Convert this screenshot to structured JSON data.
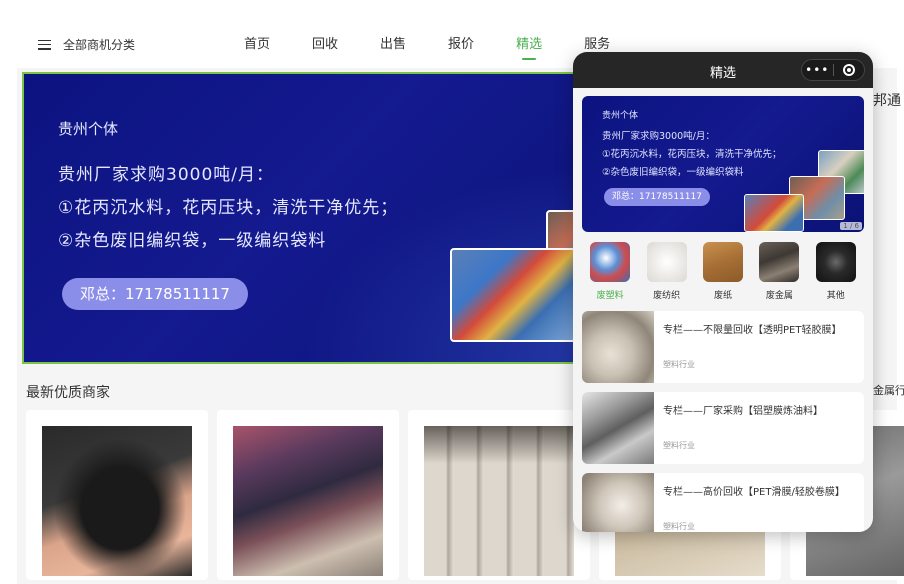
{
  "topnav": {
    "category_label": "全部商机分类",
    "items": [
      {
        "label": "首页",
        "active": false
      },
      {
        "label": "回收",
        "active": false
      },
      {
        "label": "出售",
        "active": false
      },
      {
        "label": "报价",
        "active": false
      },
      {
        "label": "精选",
        "active": true
      },
      {
        "label": "服务",
        "active": false
      }
    ],
    "accent_color": "#4caf50"
  },
  "hero": {
    "owner": "贵州个体",
    "line1": "贵州厂家求购3000吨/月：",
    "line2": "①花丙沉水料，花丙压块，清洗干净优先；",
    "line3": "②杂色废旧编织袋，一级编织袋料",
    "contact": "邓总：17178511117",
    "border_color": "#7cc544",
    "bg_color": "#0c1380"
  },
  "section": {
    "title": "最新优质商家"
  },
  "partial_right": {
    "text1": "邦通",
    "text2": "金属行"
  },
  "phone": {
    "title": "精选",
    "capsule_more": "•••",
    "banner": {
      "owner": "贵州个体",
      "line1": "贵州厂家求购3000吨/月：",
      "line2": "①花丙沉水料，花丙压块，清洗干净优先；",
      "line3": "②杂色废旧编织袋，一级编织袋料",
      "contact": "邓总：17178511117",
      "badge": "1 / 6"
    },
    "categories": [
      {
        "label": "废塑料",
        "active": true
      },
      {
        "label": "废纺织",
        "active": false
      },
      {
        "label": "废纸",
        "active": false
      },
      {
        "label": "废金属",
        "active": false
      },
      {
        "label": "其他",
        "active": false
      }
    ],
    "items": [
      {
        "title": "专栏——不限量回收【透明PET轻胶膜】",
        "tag": "塑料行业"
      },
      {
        "title": "专栏——厂家采购【铝塑膜炼油料】",
        "tag": "塑料行业"
      },
      {
        "title": "专栏——高价回收【PET滑膜/轻胶卷膜】",
        "tag": "塑料行业"
      }
    ]
  }
}
